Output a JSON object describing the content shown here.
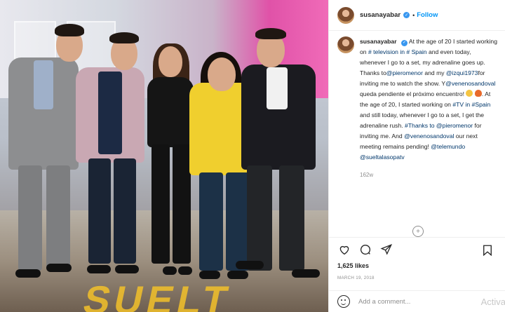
{
  "post": {
    "username": "susanayabar",
    "follow_label": "Follow",
    "dot": "•",
    "verified_icon": "verified-badge-icon"
  },
  "caption": {
    "username": "susanayabar",
    "parts": {
      "p1": "At the age of 20 I started working on ",
      "l1": "# television in # Spain",
      "p2": " and even today, whenever I go to a set, my adrenaline goes up. Thanks to",
      "l2": "@pieromenor",
      "p3": " and my ",
      "l3": "@izqui1973",
      "p4": "for inviting me to watch the show. Y",
      "l4": "@venenosandoval",
      "p5": " queda pendiente el próximo encuentro!",
      "p6": ". At the age of 20, I started working on ",
      "l5": "#TV in #Spain",
      "p7": " and still today, whenever I go to a set, I get the adrenaline rush. ",
      "l6": "#Thanks to @pieromenor",
      "p8": " for inviting me. And ",
      "l7": "@venenosandoval",
      "p9": " our next meeting remains pending! ",
      "l8": "@telemundo",
      "l9": "@sueltalasopatv"
    },
    "time_ago": "162w"
  },
  "actions": {
    "like_icon": "heart-icon",
    "comment_icon": "comment-icon",
    "share_icon": "share-icon",
    "save_icon": "bookmark-icon",
    "load_more_icon": "plus-circle-icon"
  },
  "likes": "1,625 likes",
  "date": "MARCH 19, 2018",
  "comment": {
    "placeholder": "Add a comment...",
    "emoji_icon": "smiley-icon"
  },
  "watermark": "Activa",
  "colors": {
    "accent": "#0095f6",
    "verified": "#3897f0",
    "link": "#00376b",
    "muted": "#8e8e8e"
  }
}
